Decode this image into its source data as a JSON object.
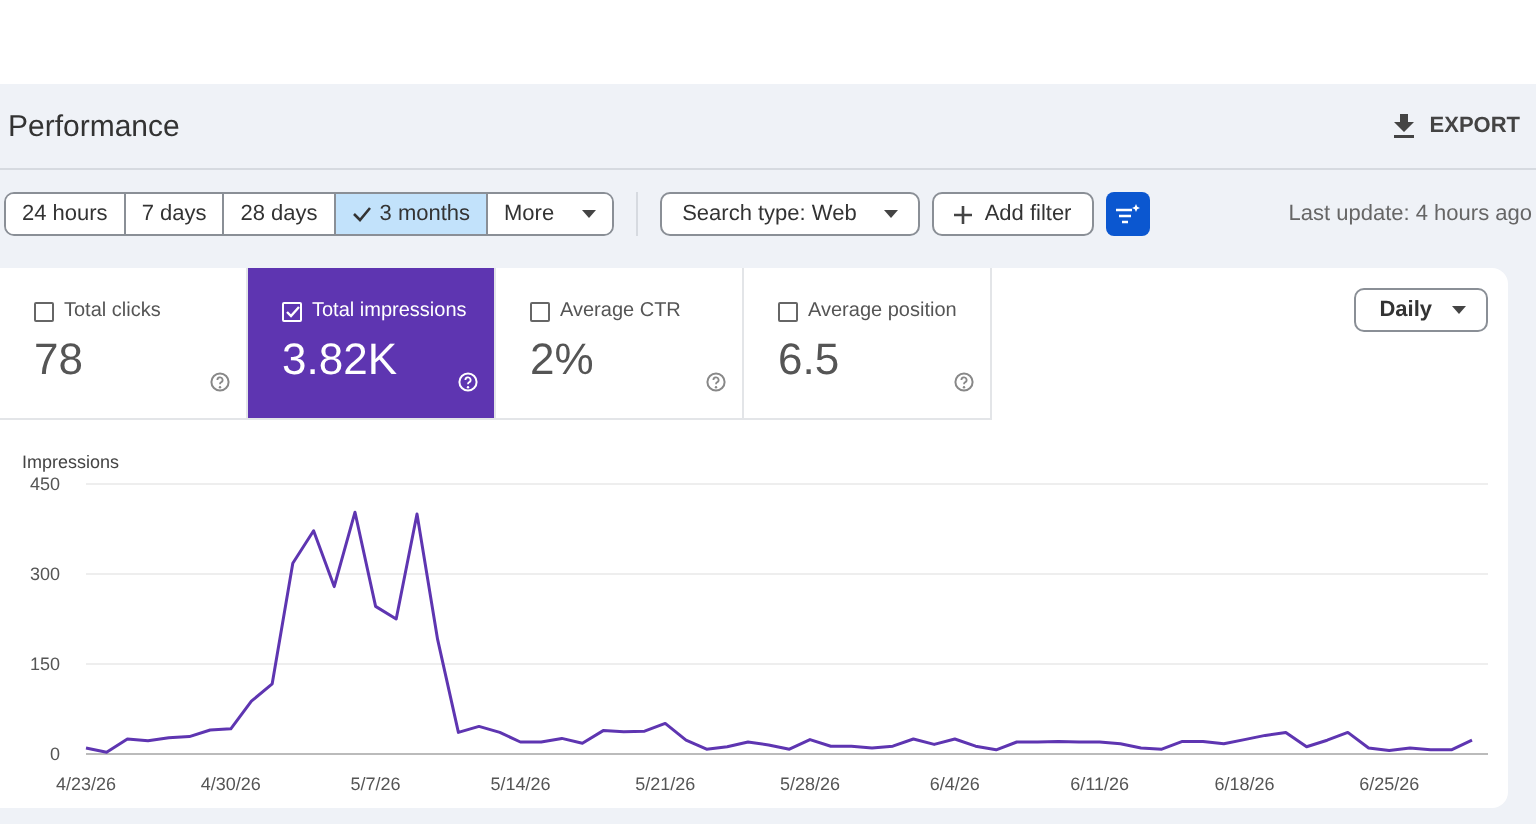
{
  "header": {
    "title": "Performance",
    "export_label": "EXPORT"
  },
  "toolbar": {
    "ranges": [
      {
        "label": "24 hours",
        "selected": false
      },
      {
        "label": "7 days",
        "selected": false
      },
      {
        "label": "28 days",
        "selected": false
      },
      {
        "label": "3 months",
        "selected": true
      }
    ],
    "more_label": "More",
    "search_type": "Search type: Web",
    "add_filter": "Add filter",
    "last_update": "Last update: 4 hours ago"
  },
  "metrics": [
    {
      "label": "Total clicks",
      "value": "78",
      "selected": false
    },
    {
      "label": "Total impressions",
      "value": "3.82K",
      "selected": true
    },
    {
      "label": "Average CTR",
      "value": "2%",
      "selected": false
    },
    {
      "label": "Average position",
      "value": "6.5",
      "selected": false
    }
  ],
  "granularity": "Daily",
  "chart": {
    "chart_data": {
      "type": "line",
      "ylabel": "Impressions",
      "ylim": [
        0,
        450
      ],
      "yticks": [
        0,
        150,
        300,
        450
      ],
      "categories": [
        "4/23/26",
        null,
        null,
        null,
        null,
        null,
        null,
        "4/30/26",
        null,
        null,
        null,
        null,
        null,
        null,
        "5/7/26",
        null,
        null,
        null,
        null,
        null,
        null,
        "5/14/26",
        null,
        null,
        null,
        null,
        null,
        null,
        "5/21/26",
        null,
        null,
        null,
        null,
        null,
        null,
        "5/28/26",
        null,
        null,
        null,
        null,
        null,
        null,
        "6/4/26",
        null,
        null,
        null,
        null,
        null,
        null,
        "6/11/26",
        null,
        null,
        null,
        null,
        null,
        null,
        "6/18/26",
        null,
        null,
        null,
        null,
        null,
        null,
        "6/25/26",
        null,
        null,
        null,
        null
      ],
      "series": [
        {
          "color": "#5e35b1",
          "values": [
            10,
            3,
            25,
            22,
            27,
            29,
            40,
            42,
            88,
            117,
            318,
            372,
            279,
            403,
            246,
            225,
            400,
            191,
            36,
            46,
            36,
            20,
            20,
            26,
            18,
            39,
            37,
            38,
            51,
            23,
            8,
            12,
            20,
            15,
            8,
            24,
            13,
            13,
            10,
            13,
            25,
            16,
            25,
            13,
            7,
            20,
            20,
            21,
            20,
            20,
            17,
            10,
            8,
            21,
            21,
            17,
            24,
            31,
            36,
            12,
            23,
            36,
            10,
            6,
            10,
            7,
            7,
            23
          ]
        }
      ]
    }
  }
}
